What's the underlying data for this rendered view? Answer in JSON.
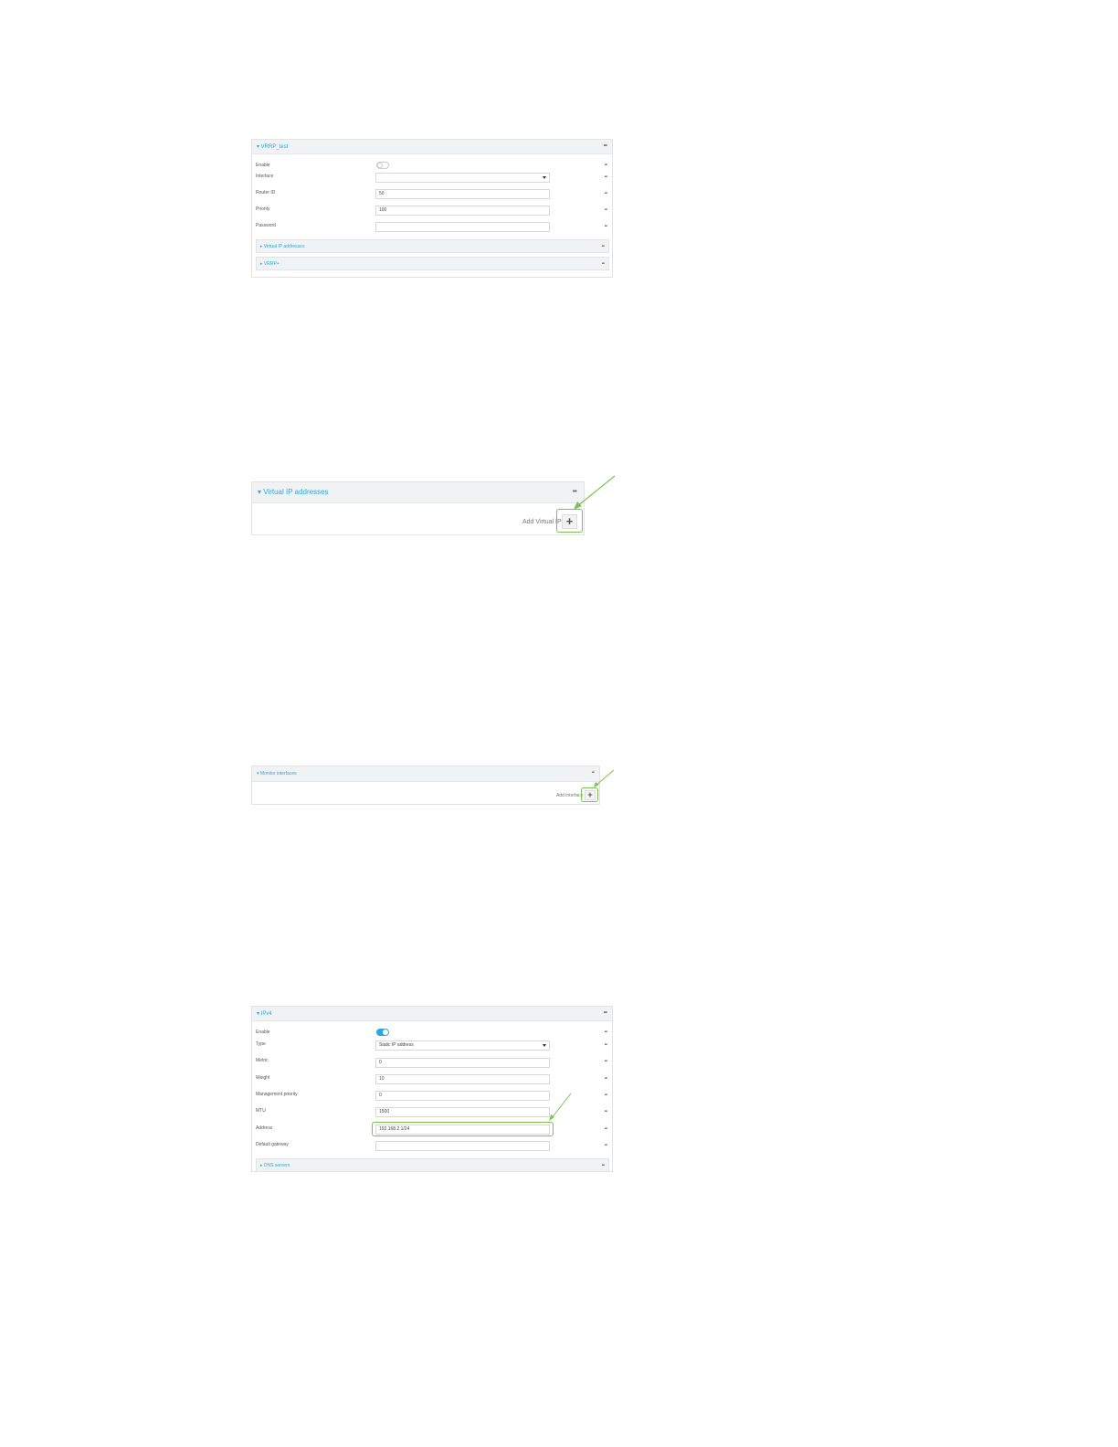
{
  "vrrp_panel": {
    "title": "▾ VRRP_test",
    "fields": [
      {
        "label": "Enable",
        "type": "toggle",
        "value": ""
      },
      {
        "label": "Interface",
        "type": "select",
        "value": ""
      },
      {
        "label": "Router ID",
        "type": "text",
        "value": "50"
      },
      {
        "label": "Priority",
        "type": "text",
        "value": "100"
      },
      {
        "label": "Password",
        "type": "text",
        "value": ""
      }
    ],
    "sections": [
      {
        "label": "▸ Virtual IP addresses"
      },
      {
        "label": "▸ VRRP+"
      }
    ]
  },
  "virtual_ip_panel": {
    "title": "▾ Virtual IP addresses",
    "add_label": "Add Virtual IP",
    "add_icon": "plus-icon"
  },
  "monitor_panel": {
    "title": "▾ Monitor interfaces",
    "add_label": "Add interface",
    "add_icon": "plus-icon"
  },
  "ipv4_panel": {
    "title": "▾ IPv4",
    "fields": [
      {
        "label": "Enable",
        "type": "toggle",
        "value": ""
      },
      {
        "label": "Type",
        "type": "select",
        "value": "Static IP address"
      },
      {
        "label": "Metric",
        "type": "text",
        "value": "0"
      },
      {
        "label": "Weight",
        "type": "text",
        "value": "10"
      },
      {
        "label": "Management priority",
        "type": "text",
        "value": "0"
      },
      {
        "label": "MTU",
        "type": "text",
        "value": "1500"
      },
      {
        "label": "Address",
        "type": "text",
        "value": "192.168.2.1/24"
      },
      {
        "label": "Default gateway",
        "type": "text",
        "value": ""
      }
    ],
    "sections": [
      {
        "label": "▸ DNS servers"
      }
    ]
  },
  "colors": {
    "accent": "#2ea8dc",
    "highlight": "#7cc251",
    "header_bg": "#f1f2f3"
  }
}
